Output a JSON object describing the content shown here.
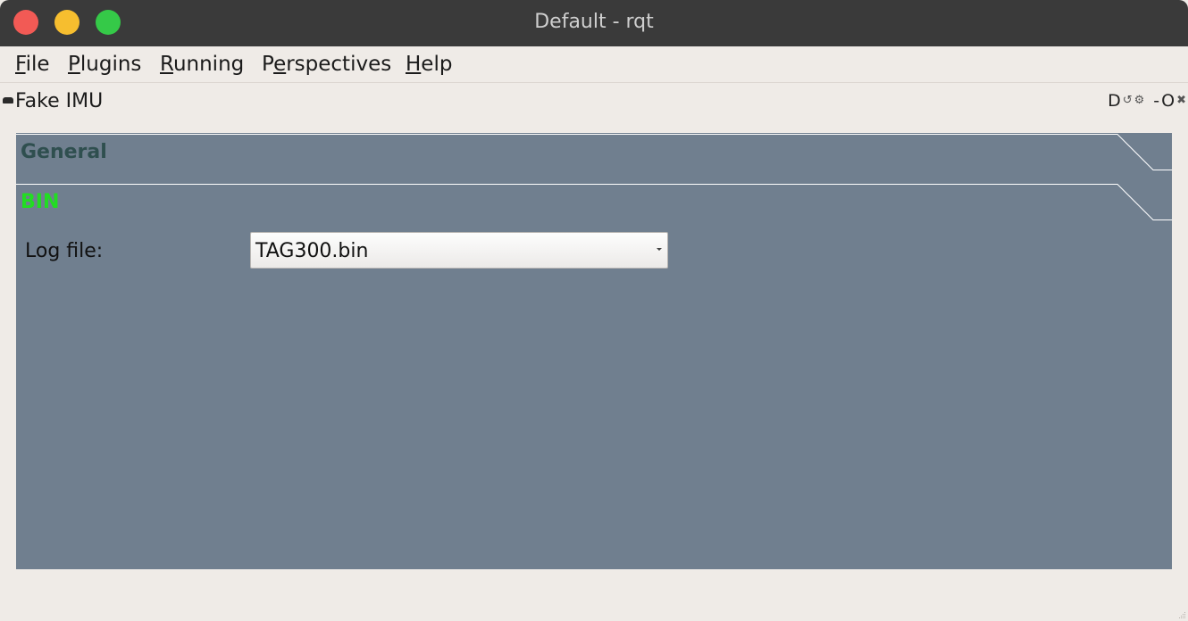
{
  "window": {
    "title": "Default - rqt",
    "controls": [
      "close",
      "minimize",
      "maximize"
    ]
  },
  "menubar": {
    "items": [
      {
        "label_rest": "ile",
        "mnemonic": "F"
      },
      {
        "label_rest": "lugins",
        "mnemonic": "P"
      },
      {
        "label_rest": "unning",
        "mnemonic": "R"
      },
      {
        "label_pre": "P",
        "mnemonic": "e",
        "label_rest": "rspectives"
      },
      {
        "label_rest": "elp",
        "mnemonic": "H"
      }
    ]
  },
  "dock": {
    "title": "Fake IMU",
    "buttons": [
      {
        "name": "help-icon",
        "glyph": "D"
      },
      {
        "name": "reload-icon",
        "glyph": "↺"
      },
      {
        "name": "settings-icon",
        "glyph": "⚙"
      },
      {
        "name": "minimize-icon",
        "glyph": "-"
      },
      {
        "name": "undock-icon",
        "glyph": "O"
      },
      {
        "name": "close-icon",
        "glyph": "✖"
      }
    ]
  },
  "panel": {
    "background_color": "#707f8f",
    "tabs": [
      {
        "label": "General",
        "color": "#2f4f4f"
      },
      {
        "label": "BIN",
        "color": "#22dd22"
      }
    ],
    "log_file": {
      "label": "Log file:",
      "selected": "TAG300.bin"
    }
  }
}
